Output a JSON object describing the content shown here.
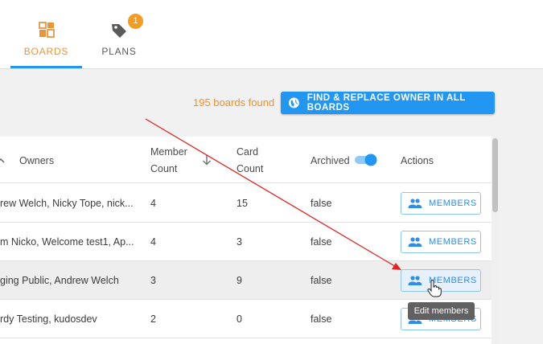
{
  "tabs": [
    {
      "label": "BOARDS",
      "icon": "boards-icon",
      "active": true
    },
    {
      "label": "PLANS",
      "icon": "tag-icon",
      "badge": "1"
    }
  ],
  "toolbar": {
    "found_text": "195 boards found",
    "find_replace_label": "FIND & REPLACE OWNER IN ALL BOARDS"
  },
  "table": {
    "headers": {
      "owners": "Owners",
      "member_count_1": "Member",
      "member_count_2": "Count",
      "card_count_1": "Card",
      "card_count_2": "Count",
      "archived": "Archived",
      "actions": "Actions"
    },
    "archived_toggle_on": true,
    "rows": [
      {
        "owners": "rew Welch, Nicky Tope, nick...",
        "member_count": "4",
        "card_count": "15",
        "archived": "false",
        "action": "MEMBERS"
      },
      {
        "owners": "m Nicko, Welcome test1, Ap...",
        "member_count": "4",
        "card_count": "3",
        "archived": "false",
        "action": "MEMBERS"
      },
      {
        "owners": "ging Public, Andrew Welch",
        "member_count": "3",
        "card_count": "9",
        "archived": "false",
        "action": "MEMBERS"
      },
      {
        "owners": "rdy Testing, kudosdev",
        "member_count": "2",
        "card_count": "0",
        "archived": "false",
        "action": "MEMBERS"
      }
    ]
  },
  "tooltip": "Edit members",
  "colors": {
    "accent_blue": "#2196f3",
    "accent_orange": "#f0922c",
    "annotation_red": "#e52222"
  }
}
